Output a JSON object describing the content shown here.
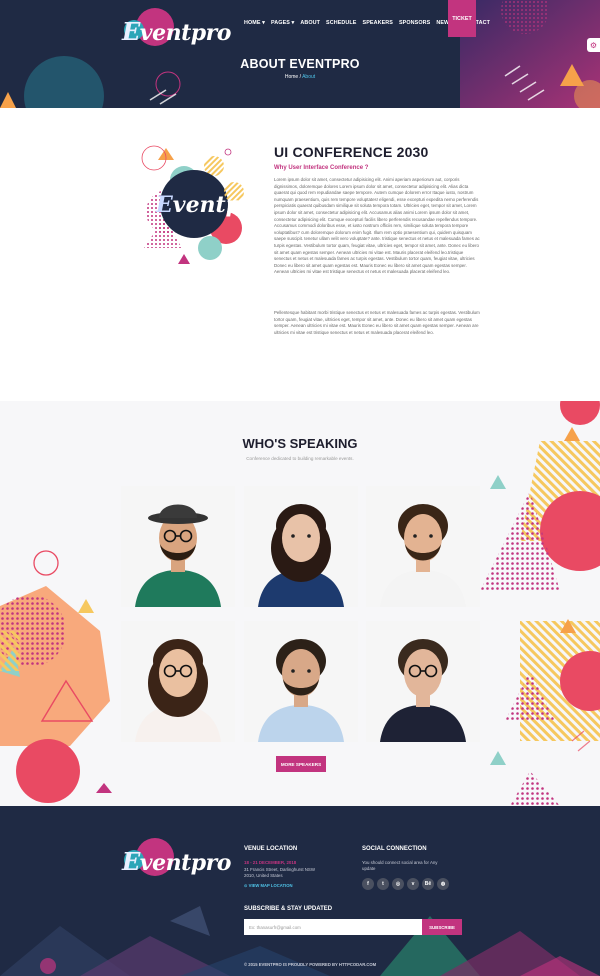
{
  "brand": {
    "logo_first": "E",
    "logo_rest": "ventpro",
    "accent": "#c2347f",
    "dark": "#1f2a44",
    "link": "#4fc3e8"
  },
  "nav": {
    "items": [
      "HOME ▾",
      "PAGES ▾",
      "ABOUT",
      "SCHEDULE",
      "SPEAKERS",
      "SPONSORS",
      "NEWS ▾",
      "CONTACT"
    ],
    "ticket": "TICKET"
  },
  "hero": {
    "title": "ABOUT EVENTPRO",
    "breadcrumb_home": "Home",
    "breadcrumb_sep": "/",
    "breadcrumb_current": "About"
  },
  "about": {
    "title": "UI CONFERENCE 2030",
    "subtitle": "Why User Interface Conference ?",
    "p1": "Lorem ipsum dolor sit amet, consectetur adipisicing elit. Animi aperiam asperiorum aut, corporis dignissimos, doloremque dolores Lorem ipsum dolor sit amet, consectetur adipisicing elit. Alias dicta quaerat qui quod rem repudiandae saepe tempore. Autem cumque dolorem error Itaque iusto, nostrum numquam praesentium, quis rem tempore voluptates! eligendi, esse excepturi expedita nemo perferendis perspiciatis quaerat quibusdam similique sit soluta tempora totam. Ultricies eget, tempor sit amet, Lorem ipsum dolor sit amet, consectetur adipisicing elit. Accusamus alias animi Lorem ipsum dolor sit amet, consectetur adipisicing elit. Cumque excepturi facilis libero perferendis recusandae repellendus tempore. Accusamus commodi doloribus esse, et iusto nostrum officiis rem, similique soluta tempora tempore voluptatibus? cum doloremque dolorum enim fugit. Illum rem optio praesentium qui, quidem quisquam saepe suscipit. tenetur ullam velit vero voluptate? ante. tristique senectus et netus et malesuada fames ac turpis egestas. Vestibulum tortor quam, feugiat vitae, ultricies eget, tempor sit amet, ante. Donec eu libero sit amet quam egestas semper. Aenean ultricies mi vitae est. Mauris placerat eleifend leo.tristique senectus et netus et malesuada fames ac turpis egestas. Vestibulum tortor quam, feugiat vitae, ultricies Donec eu libero sit amet quam egestas est. Mauris Eonec eu libero sit amet quam egestas semper. Aenean ultricies mi vitae est tristique senectus et netus et malesuada placerat eleifend leo.",
    "p2": "Pellentesque habitant morbi tristique senectus et netus et malesuada fames ac turpis egestas. Vestibulum tortor quam, feugiat vitae, ultricies eget, tempor sit amet, ante. Donec eu libero sit amet quam egestas semper. Aenean ultricies mi vitae est. Mauris Eonec eu libero sit amet quam egestas semper. Aenean are ultricies mi vitae est tristique senectus et netus et malesuada placerat eleifend leo."
  },
  "speakers": {
    "title": "WHO'S SPEAKING",
    "subtitle": "Conference dedicated to building remarkable events.",
    "more_button": "MORE SPEAKERS",
    "people": [
      {
        "hair": "#2b1d12",
        "skin": "#d9a47f",
        "shirt": "#1f7a5c",
        "beard": true,
        "hat": true,
        "glasses": true
      },
      {
        "hair": "#2a1a14",
        "skin": "#e8c2a8",
        "shirt": "#1d3a6e",
        "beard": false,
        "hat": false,
        "glasses": false
      },
      {
        "hair": "#3a2617",
        "skin": "#e3b392",
        "shirt": "#f4f4f4",
        "beard": true,
        "hat": false,
        "glasses": false
      },
      {
        "hair": "#3b2417",
        "skin": "#eac0a0",
        "shirt": "#f7f1ee",
        "beard": false,
        "hat": false,
        "glasses": true
      },
      {
        "hair": "#2c2118",
        "skin": "#d8a888",
        "shirt": "#bcd4ec",
        "beard": true,
        "hat": false,
        "glasses": false
      },
      {
        "hair": "#3a2a1e",
        "skin": "#e2b69a",
        "shirt": "#1e2235",
        "beard": false,
        "hat": false,
        "glasses": true
      }
    ]
  },
  "footer": {
    "venue_head": "VENUE LOCATION",
    "date": "18 - 21 DECEMBER, 2018",
    "address": "31 Francis Street, Darlinghurst NSW 2010, United States",
    "map_link": "⊙ VIEW MAP LOCATION",
    "social_head": "SOCIAL CONNECTION",
    "social_text": "You should connect social area for Any update",
    "socials": [
      {
        "name": "facebook-icon",
        "glyph": "f"
      },
      {
        "name": "twitter-icon",
        "glyph": "t"
      },
      {
        "name": "instagram-icon",
        "glyph": "◎"
      },
      {
        "name": "vimeo-icon",
        "glyph": "v"
      },
      {
        "name": "behance-icon",
        "glyph": "Bē"
      },
      {
        "name": "dribbble-icon",
        "glyph": "◍"
      }
    ],
    "subscribe_head": "SUBSCRIBE & STAY UPDATED",
    "subscribe_placeholder": "Ex: thanasurfr@gmail.com",
    "subscribe_button": "SUBSCRIBE",
    "copyright": "© 2015 EVENTPRO IS PROUDLY POWERED BY HTTPCODAR.COM"
  }
}
